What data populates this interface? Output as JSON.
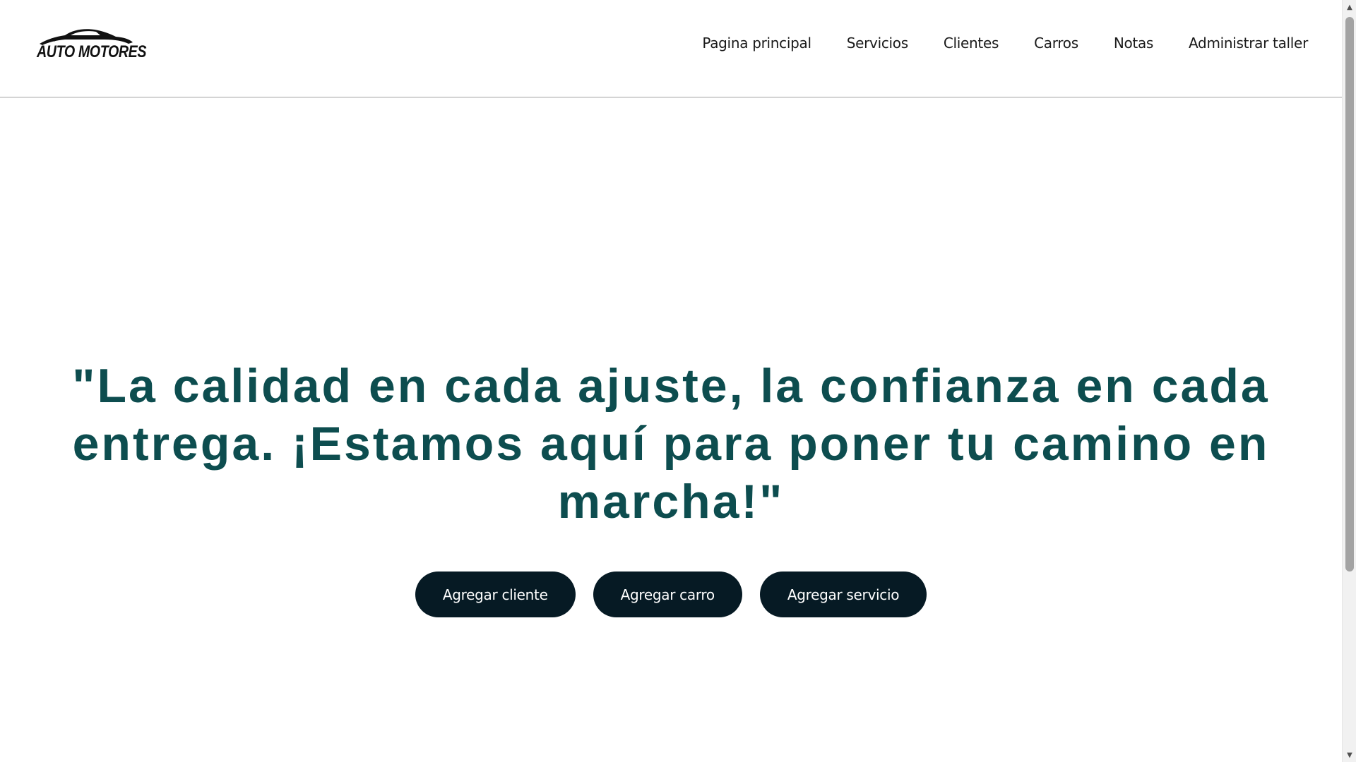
{
  "header": {
    "logo_text": "AUTO MOTORES",
    "nav": [
      {
        "label": "Pagina principal"
      },
      {
        "label": "Servicios"
      },
      {
        "label": "Clientes"
      },
      {
        "label": "Carros"
      },
      {
        "label": "Notas"
      },
      {
        "label": "Administrar taller"
      }
    ]
  },
  "hero": {
    "quote": "\"La calidad en cada ajuste, la confianza en cada entrega. ¡Estamos aquí para poner tu camino en marcha!\"",
    "buttons": [
      {
        "label": "Agregar cliente"
      },
      {
        "label": "Agregar carro"
      },
      {
        "label": "Agregar servicio"
      }
    ]
  },
  "colors": {
    "quote_text": "#0d4d4f",
    "button_bg": "#061a24",
    "button_text": "#ffffff",
    "header_border": "#d4d4d4"
  },
  "icons": {
    "logo": "car-silhouette-icon",
    "scroll_up": "triangle-up-icon",
    "scroll_down": "triangle-down-icon"
  }
}
